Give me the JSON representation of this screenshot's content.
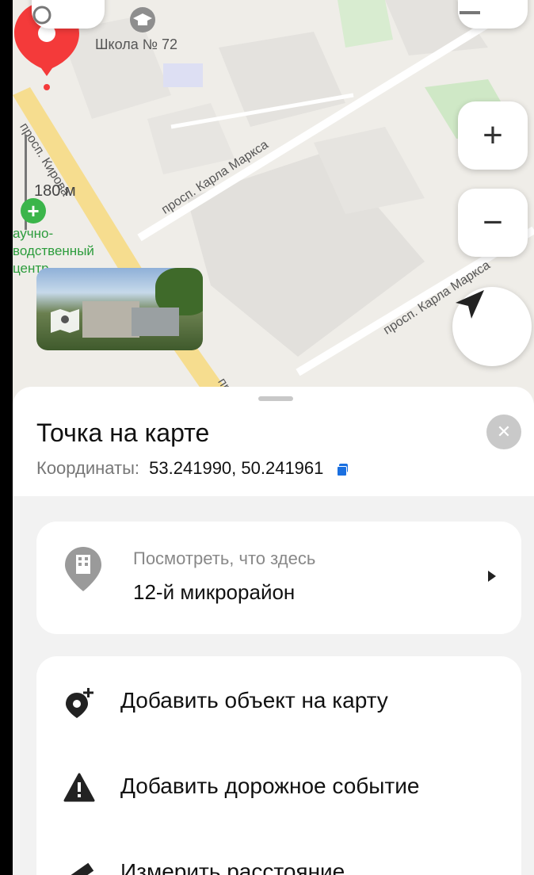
{
  "map": {
    "school_label": "Школа № 72",
    "streets": [
      "просп. Кирова",
      "просп. Карла Маркса",
      "просп. Карла Маркса",
      "пр"
    ],
    "scale": "180 м",
    "poi_text": "аучно-\nводственный\nцентр",
    "buttons": {
      "zoom_in": "+",
      "zoom_out": "−"
    }
  },
  "sheet": {
    "title": "Точка на карте",
    "coords_label": "Координаты:",
    "coords_value": "53.241990, 50.241961",
    "what_here": {
      "subtitle": "Посмотреть, что здесь",
      "value": "12-й микрорайон"
    },
    "actions": [
      {
        "label": "Добавить объект на карту",
        "icon": "add-place-icon"
      },
      {
        "label": "Добавить дорожное событие",
        "icon": "warning-icon"
      },
      {
        "label": "Измерить расстояние",
        "icon": "ruler-icon"
      }
    ]
  },
  "colors": {
    "pin": "#f43a3a",
    "copy": "#1a6fe0",
    "poi": "#3bb54a"
  }
}
